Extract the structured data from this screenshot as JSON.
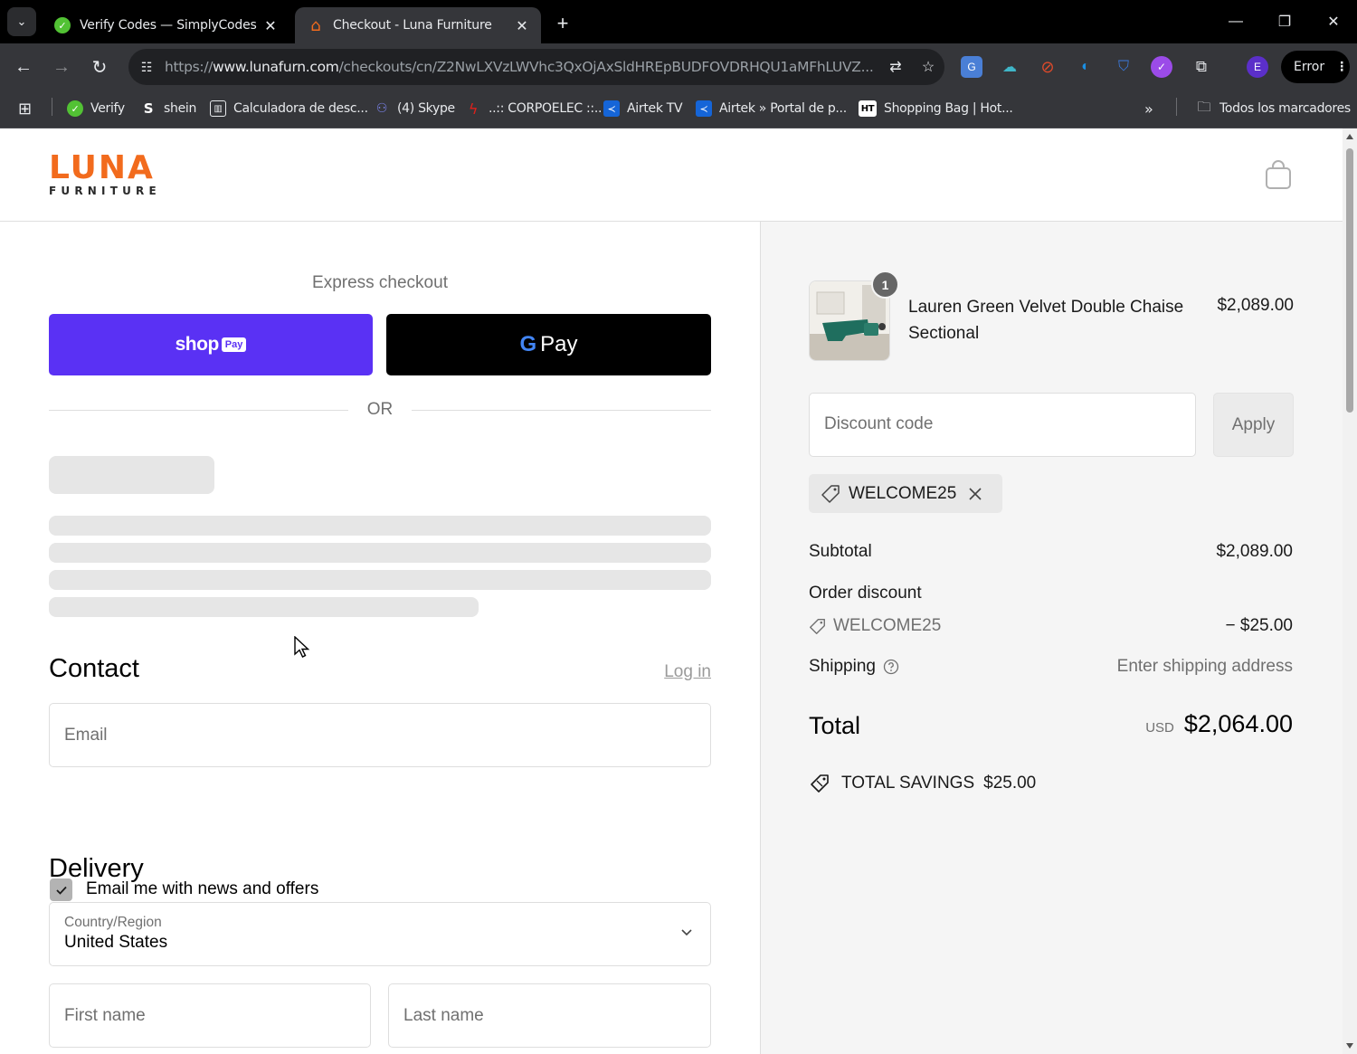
{
  "browser": {
    "tabs": [
      {
        "title": "Verify Codes — SimplyCodes",
        "active": false
      },
      {
        "title": "Checkout - Luna Furniture",
        "active": true
      }
    ],
    "url_scheme": "https://",
    "url_host": "www.lunafurn.com",
    "url_path": "/checkouts/cn/Z2NwLXVzLWVhc3QxOjAxSldHREpBUDFOVDRHQU1aMFhLUVZ...",
    "profile_initial": "E",
    "error_label": "Error",
    "bookmarks": [
      {
        "label": "Verify",
        "icon": "simplycodes-icon"
      },
      {
        "label": "shein",
        "icon": "shein-icon"
      },
      {
        "label": "Calculadora de desc...",
        "icon": "calculator-icon"
      },
      {
        "label": "(4) Skype",
        "icon": "teams-icon"
      },
      {
        "label": "..:: CORPOELEC ::..",
        "icon": "corpoelec-icon"
      },
      {
        "label": "Airtek TV",
        "icon": "airtek-icon"
      },
      {
        "label": "Airtek » Portal de p...",
        "icon": "airtek-icon"
      },
      {
        "label": "Shopping Bag | Hot...",
        "icon": "ht-icon"
      }
    ],
    "all_bookmarks_label": "Todos los marcadores"
  },
  "brand": {
    "logo_main": "LUNA",
    "logo_sub": "FURNITURE",
    "accent_color": "#f26b1d"
  },
  "checkout": {
    "express_title": "Express checkout",
    "shop_pay_word": "shop",
    "shop_pay_pill": "Pay",
    "gpay_g": "G",
    "gpay_pay": "Pay",
    "or_text": "OR",
    "contact": {
      "title": "Contact",
      "login_link": "Log in",
      "email_placeholder": "Email",
      "newsletter_label": "Email me with news and offers",
      "newsletter_checked": true
    },
    "delivery": {
      "title": "Delivery",
      "country_label": "Country/Region",
      "country_value": "United States",
      "first_name_placeholder": "First name",
      "last_name_placeholder": "Last name"
    }
  },
  "summary": {
    "item": {
      "name": "Lauren Green Velvet Double Chaise Sectional",
      "price": "$2,089.00",
      "quantity": "1"
    },
    "discount_placeholder": "Discount code",
    "apply_label": "Apply",
    "applied_code": "WELCOME25",
    "subtotal_label": "Subtotal",
    "subtotal_value": "$2,089.00",
    "order_discount_label": "Order discount",
    "order_discount_code": "WELCOME25",
    "order_discount_value": "− $25.00",
    "shipping_label": "Shipping",
    "shipping_value": "Enter shipping address",
    "total_label": "Total",
    "total_currency": "USD",
    "total_value": "$2,064.00",
    "savings_label": "TOTAL SAVINGS",
    "savings_value": "$25.00"
  }
}
